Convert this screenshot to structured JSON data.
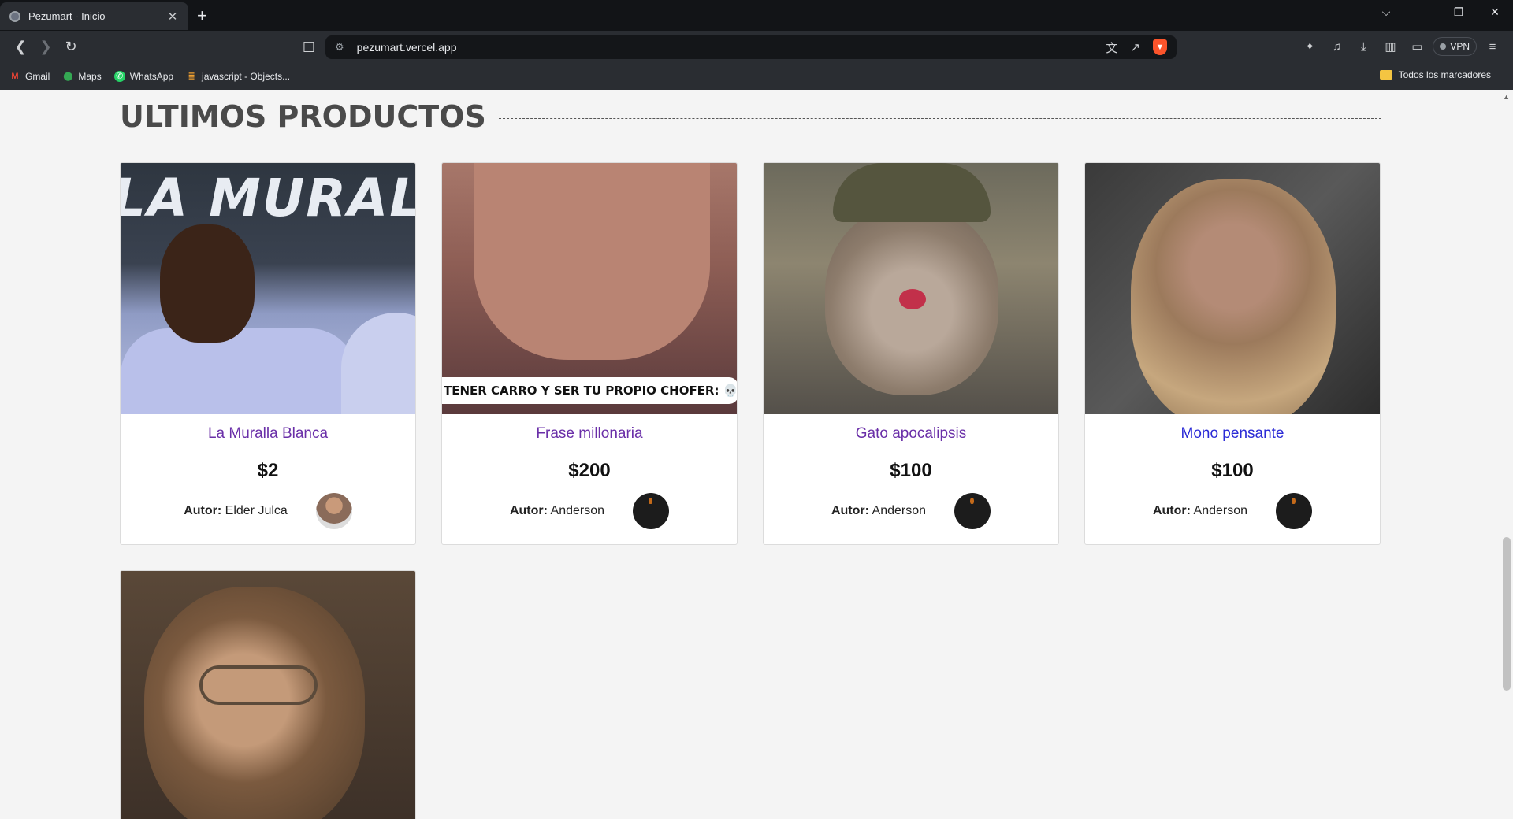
{
  "browser": {
    "tab_title": "Pezumart - Inicio",
    "tab_close": "✕",
    "new_tab": "+",
    "url": "pezumart.vercel.app",
    "window_controls": {
      "dropdown": "⌵",
      "minimize": "—",
      "restore": "❐",
      "close": "✕"
    },
    "vpn_label": "VPN",
    "bookmarks": [
      {
        "label": "Gmail",
        "icon": "gmail-icon"
      },
      {
        "label": "Maps",
        "icon": "maps-icon"
      },
      {
        "label": "WhatsApp",
        "icon": "whatsapp-icon"
      },
      {
        "label": "javascript - Objects...",
        "icon": "stackoverflow-icon"
      }
    ],
    "all_bookmarks": "Todos los marcadores"
  },
  "page": {
    "section_title": "ULTIMOS PRODUCTOS",
    "author_prefix": "Autor:",
    "products": [
      {
        "name": "La Muralla Blanca",
        "price": "$2",
        "author": "Elder Julca"
      },
      {
        "name": "Frase millonaria",
        "price": "$200",
        "author": "Anderson"
      },
      {
        "name": "Gato apocalipsis",
        "price": "$100",
        "author": "Anderson"
      },
      {
        "name": "Mono pensante",
        "price": "$100",
        "author": "Anderson"
      }
    ],
    "image_text": {
      "banner": "LA MURAL",
      "meme": "TENER CARRO Y SER TU PROPIO CHOFER: 💀"
    }
  }
}
